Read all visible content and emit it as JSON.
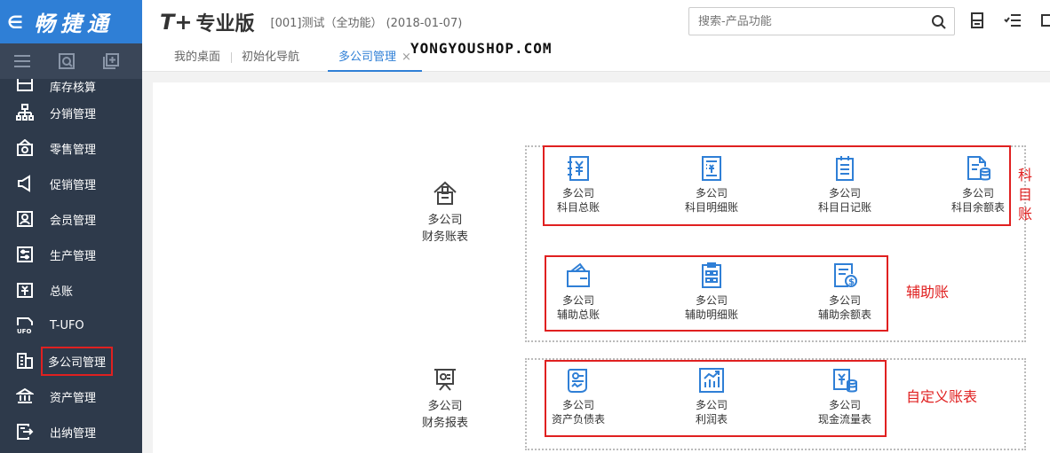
{
  "sidebar": {
    "brand_back": "∈",
    "brand_name": "畅捷通",
    "tools": [
      "menu-icon",
      "search-doc-icon",
      "add-doc-icon"
    ],
    "items": [
      {
        "label": "库存核算",
        "icon": "inventory-icon"
      },
      {
        "label": "分销管理",
        "icon": "distribution-icon"
      },
      {
        "label": "零售管理",
        "icon": "retail-icon"
      },
      {
        "label": "促销管理",
        "icon": "promotion-icon"
      },
      {
        "label": "会员管理",
        "icon": "member-icon"
      },
      {
        "label": "生产管理",
        "icon": "production-icon"
      },
      {
        "label": "总账",
        "icon": "ledger-icon"
      },
      {
        "label": "T-UFO",
        "icon": "ufo-icon"
      },
      {
        "label": "多公司管理",
        "icon": "multi-company-icon"
      },
      {
        "label": "资产管理",
        "icon": "asset-icon"
      },
      {
        "label": "出纳管理",
        "icon": "cashier-icon"
      }
    ]
  },
  "header": {
    "logo_mark": "T+",
    "logo_text": "专业版",
    "account": "[001]测试（全功能）  (2018-01-07)",
    "search_placeholder": "搜索-产品功能"
  },
  "tabs": [
    {
      "label": "我的桌面"
    },
    {
      "label": "初始化导航"
    },
    {
      "label": "多公司管理",
      "close": "×"
    }
  ],
  "watermark": "YONGYOUSHOP.COM",
  "groups": {
    "finance_books": {
      "line1": "多公司",
      "line2": "财务账表"
    },
    "finance_reports": {
      "line1": "多公司",
      "line2": "财务报表"
    }
  },
  "subject_books": [
    {
      "line1": "多公司",
      "line2": "科目总账"
    },
    {
      "line1": "多公司",
      "line2": "科目明细账"
    },
    {
      "line1": "多公司",
      "line2": "科目日记账"
    },
    {
      "line1": "多公司",
      "line2": "科目余额表"
    }
  ],
  "aux_books": [
    {
      "line1": "多公司",
      "line2": "辅助总账"
    },
    {
      "line1": "多公司",
      "line2": "辅助明细账"
    },
    {
      "line1": "多公司",
      "line2": "辅助余额表"
    }
  ],
  "reports": [
    {
      "line1": "多公司",
      "line2": "资产负债表"
    },
    {
      "line1": "多公司",
      "line2": "利润表"
    },
    {
      "line1": "多公司",
      "line2": "现金流量表"
    }
  ],
  "annotations": {
    "subject": [
      "科",
      "目",
      "账"
    ],
    "aux": "辅助账",
    "custom": "自定义账表"
  },
  "colors": {
    "accent": "#2f7fd6",
    "sidebar": "#2e3a4b",
    "highlight": "#e02020"
  }
}
